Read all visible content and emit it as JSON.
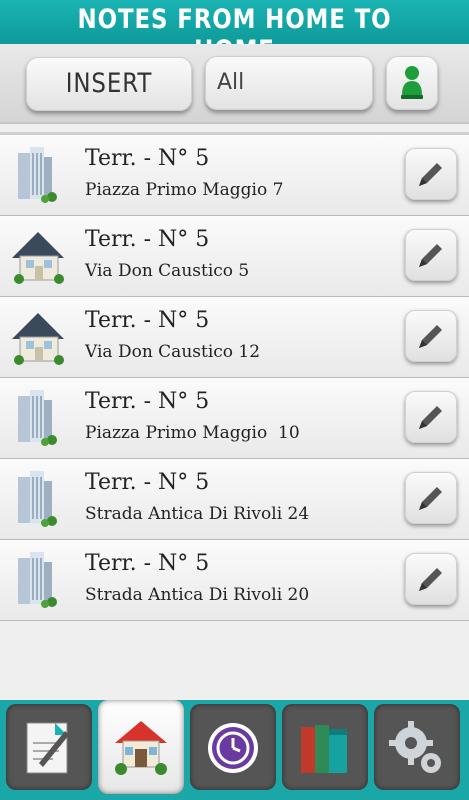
{
  "header": {
    "title": "NOTES FROM HOME TO HOME"
  },
  "toolbar": {
    "insert_label": "INSERT",
    "filter_value": "All",
    "user_icon": "user-icon"
  },
  "rows": [
    {
      "icon": "apartment-building-icon",
      "line1": "Terr. - N° 5",
      "line2": "Piazza Primo Maggio 7"
    },
    {
      "icon": "house-icon",
      "line1": "Terr. - N° 5",
      "line2": "Via Don Caustico 5"
    },
    {
      "icon": "house-icon",
      "line1": "Terr. - N° 5",
      "line2": "Via Don Caustico 12"
    },
    {
      "icon": "apartment-building-icon",
      "line1": "Terr. - N° 5",
      "line2": "Piazza Primo Maggio  10"
    },
    {
      "icon": "apartment-building-icon",
      "line1": "Terr. - N° 5",
      "line2": "Strada Antica Di Rivoli 24"
    },
    {
      "icon": "apartment-building-icon",
      "line1": "Terr. - N° 5",
      "line2": "Strada Antica Di Rivoli 20"
    }
  ],
  "tabs": [
    {
      "icon": "notes-icon",
      "active": false
    },
    {
      "icon": "home-icon",
      "active": true
    },
    {
      "icon": "history-icon",
      "active": false
    },
    {
      "icon": "books-icon",
      "active": false
    },
    {
      "icon": "settings-icon",
      "active": false
    }
  ],
  "colors": {
    "accent": "#1bb3b3",
    "tab_dark": "#555555",
    "user_green": "#1e9e3a"
  }
}
